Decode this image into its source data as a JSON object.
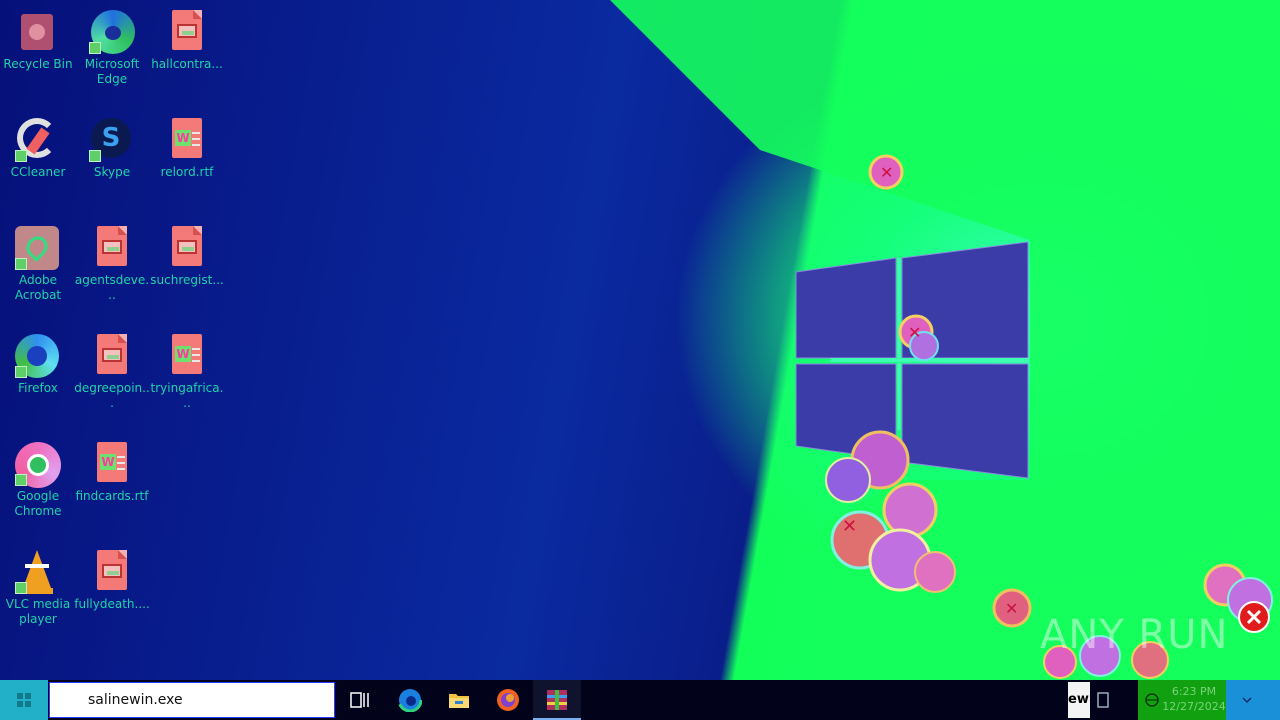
{
  "desktop": {
    "icons": [
      {
        "label": "Recycle Bin",
        "icon": "recycle-bin-icon"
      },
      {
        "label": "Microsoft Edge",
        "icon": "edge-icon"
      },
      {
        "label": "hallcontra...",
        "icon": "image-file-icon"
      },
      {
        "label": "CCleaner",
        "icon": "ccleaner-icon"
      },
      {
        "label": "Skype",
        "icon": "skype-icon"
      },
      {
        "label": "relord.rtf",
        "icon": "rtf-file-icon"
      },
      {
        "label": "Adobe Acrobat",
        "icon": "acrobat-icon"
      },
      {
        "label": "agentsdeve...",
        "icon": "image-file-icon"
      },
      {
        "label": "suchregist...",
        "icon": "image-file-icon"
      },
      {
        "label": "Firefox",
        "icon": "firefox-icon"
      },
      {
        "label": "degreepoin...",
        "icon": "image-file-icon"
      },
      {
        "label": "tryingafrica...",
        "icon": "rtf-file-icon"
      },
      {
        "label": "Google Chrome",
        "icon": "chrome-icon"
      },
      {
        "label": "findcards.rtf",
        "icon": "rtf-file-icon"
      },
      {
        "label": "VLC media player",
        "icon": "vlc-icon"
      },
      {
        "label": "fullydeath....",
        "icon": "image-file-icon"
      }
    ],
    "watermark": "ANY RUN"
  },
  "taskbar": {
    "search_value": "salinewin.exe",
    "apps": [
      "task-view-icon",
      "edge-icon",
      "file-explorer-icon",
      "firefox-icon",
      "winrar-icon"
    ],
    "tray_box_text": "ewi",
    "clock_time": "6:23 PM",
    "clock_date": "12/27/2024"
  },
  "colors": {
    "accent": "#22b0c8",
    "tray_green": "#10a010",
    "wallpaper_green": "#1cff5e"
  }
}
